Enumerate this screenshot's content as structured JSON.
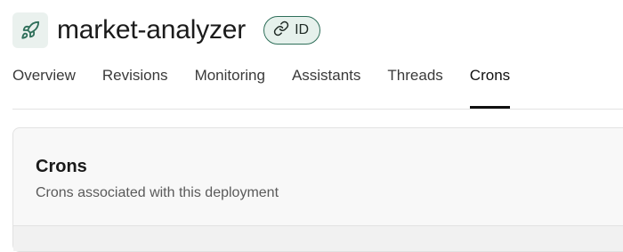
{
  "header": {
    "title": "market-analyzer",
    "icon": "rocket-icon",
    "id_badge": {
      "label": "ID",
      "icon": "link-icon"
    }
  },
  "tabs": [
    {
      "label": "Overview"
    },
    {
      "label": "Revisions"
    },
    {
      "label": "Monitoring"
    },
    {
      "label": "Assistants"
    },
    {
      "label": "Threads"
    },
    {
      "label": "Crons",
      "active": true
    }
  ],
  "card": {
    "title": "Crons",
    "subtitle": "Crons associated with this deployment"
  },
  "colors": {
    "accent": "#2f6f5a",
    "badge_bg": "#e6f1ec",
    "icon_bg": "#eaf1ee"
  }
}
